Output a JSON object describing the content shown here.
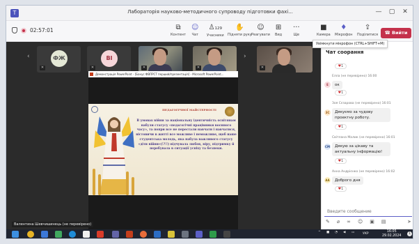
{
  "window": {
    "title": "Лабораторія науково-методичного супроводу підготовки фахі...",
    "minimize": "—",
    "restore": "▢",
    "close": "✕"
  },
  "toolbar": {
    "timer": "02:57:01",
    "items": [
      {
        "label": "Контент",
        "icon": "⧉"
      },
      {
        "label": "Чат",
        "icon": "☺"
      },
      {
        "label": "Учасники",
        "icon": "♙",
        "count": "129"
      },
      {
        "label": "Підняти руку",
        "icon": "✋"
      },
      {
        "label": "Реагувати",
        "icon": "☺"
      },
      {
        "label": "Вид",
        "icon": "⊞"
      },
      {
        "label": "Ще",
        "icon": "···"
      },
      {
        "label": "Камера",
        "icon": "■"
      },
      {
        "label": "Мікрофон",
        "icon": "♦"
      },
      {
        "label": "Поділитися",
        "icon": "⇪"
      }
    ],
    "leave": "Вийти",
    "mic_tooltip": "Увімкнути мікрофон (CTRL+SHIFT+M)"
  },
  "participants": [
    {
      "initials": "ФЖ",
      "color": "#e4e8d6",
      "text_color": "#555"
    },
    {
      "initials": "ВІ",
      "color": "#f6d6d9",
      "text_color": "#a03040"
    }
  ],
  "presenter_label": "Валентина Шевчишинець (не перевірено)",
  "share": {
    "app_title": "Демонстрація PowerPoint - [Бонус ФВПРСТ перший/презентація] - Microsoft PowerPoint...",
    "slide_subtitle": "ПЕДАГОГІЧНОЇ МАЙСТЕРНОСТІ",
    "slide_text": "В умовах війни за національну ідентичність освітянам набули статусу «педагогічні працівники воєнного часу», та попри все не перестали навчати і навчатися, вістовичи в житті все можливе і неможливе, щоб наше студентська молодь, яка набула важливого статусу «діти війни»(!?!!) відчувала любов, віру, підтримку й перебувала в ситуації успіху та безпеки."
  },
  "chat": {
    "header": "Чат соорання",
    "messages": [
      {
        "reaction": "1",
        "author": "",
        "time": "",
        "text": ""
      },
      {
        "author": "Елла (не перевірено)",
        "time": "16:00",
        "avatar": "Е",
        "avatar_color": "#f7d9dc",
        "text": "ок",
        "reaction": "1"
      },
      {
        "author": "Зоя Сєзарова (не перевірено)",
        "time": "16:01",
        "avatar": "ЗС",
        "avatar_color": "#fde7c8",
        "text": "Дякуємо за чудову проектну роботу.",
        "reaction": "1"
      },
      {
        "author": "Світлана Малик (не перевірено)",
        "time": "16:01",
        "avatar": "СМ",
        "avatar_color": "#d9e4f5",
        "text": "Дякую за цікаву та актуальну  інформацію!",
        "reaction": "1"
      },
      {
        "author": "Анна Андрієнко (не перевірено)",
        "time": "16:02",
        "avatar": "АА",
        "avatar_color": "#fdf0c3",
        "text": "Доброго дня",
        "reaction": "1"
      }
    ],
    "compose_placeholder": "Введите сообщение"
  },
  "taskbar": {
    "lang": "УКР",
    "time": "16:05",
    "date": "29.02.2024",
    "notification_count": "1"
  },
  "colors": {
    "accent": "#5b5fc7",
    "leave": "#c4314b",
    "stage": "#2b2b2b"
  }
}
